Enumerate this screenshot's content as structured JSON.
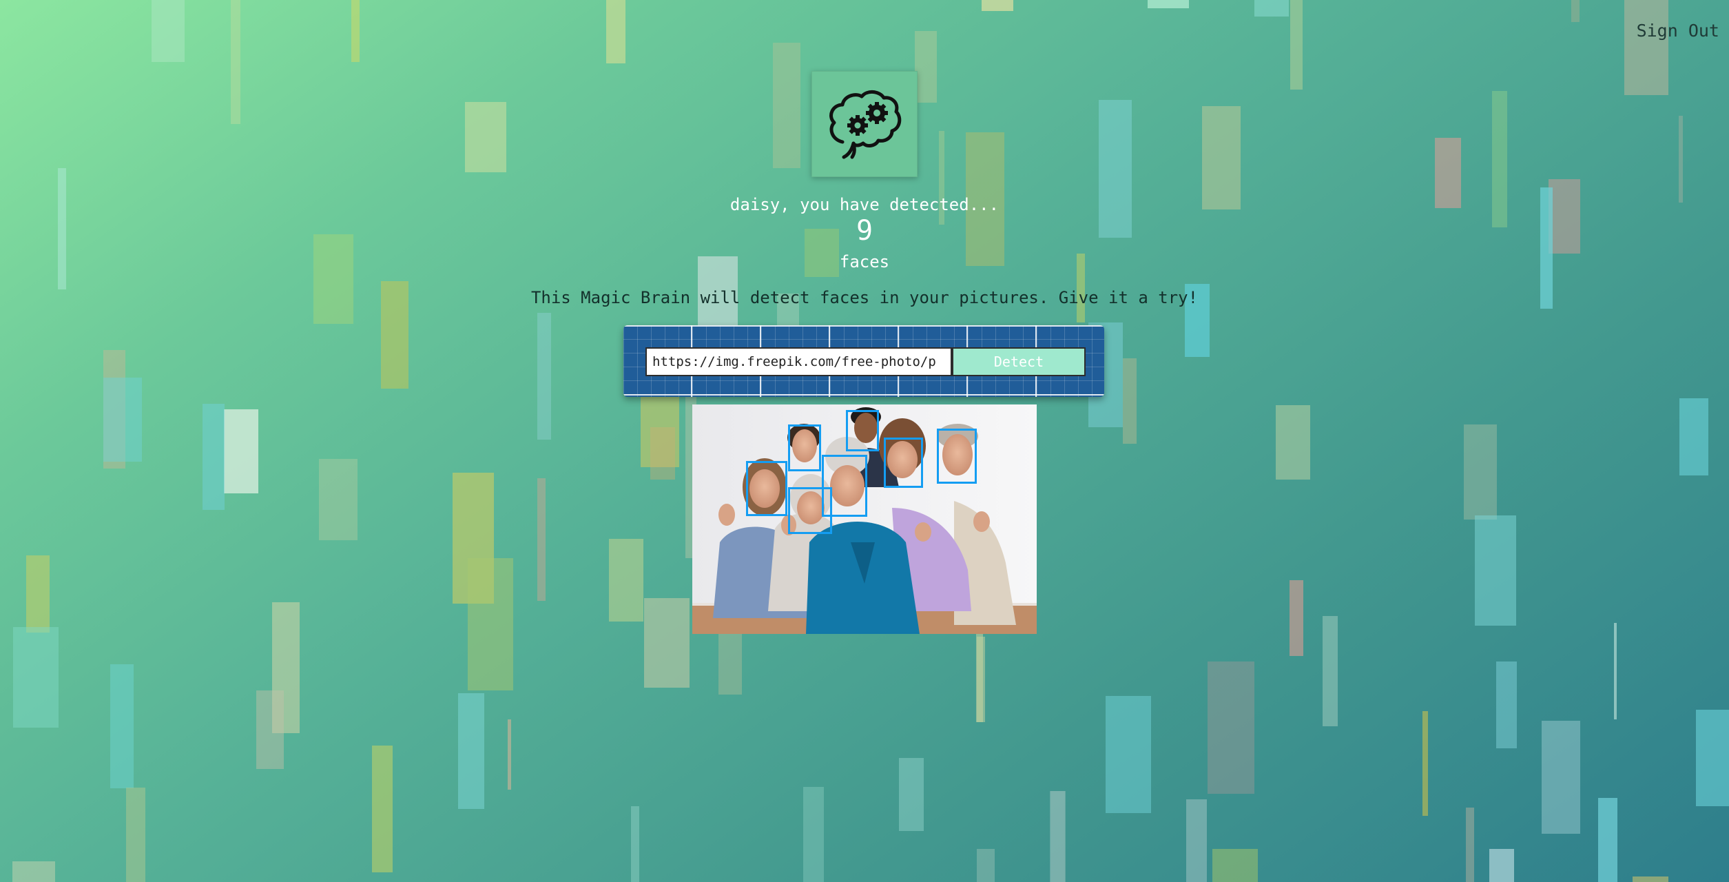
{
  "header": {
    "sign_out_label": "Sign Out"
  },
  "logo": {
    "icon": "brain-gears-icon"
  },
  "rank": {
    "line": "daisy, you have detected...",
    "count": "9",
    "unit": "faces"
  },
  "tagline": "This Magic Brain will detect faces in your pictures. Give it a try!",
  "form": {
    "url_value": "https://img.freepik.com/free-photo/p",
    "detect_label": "Detect"
  },
  "result": {
    "faces_detected": 9
  },
  "colors": {
    "panel": "#205d99",
    "button": "#9fe9ce",
    "face_box": "#149df2"
  }
}
